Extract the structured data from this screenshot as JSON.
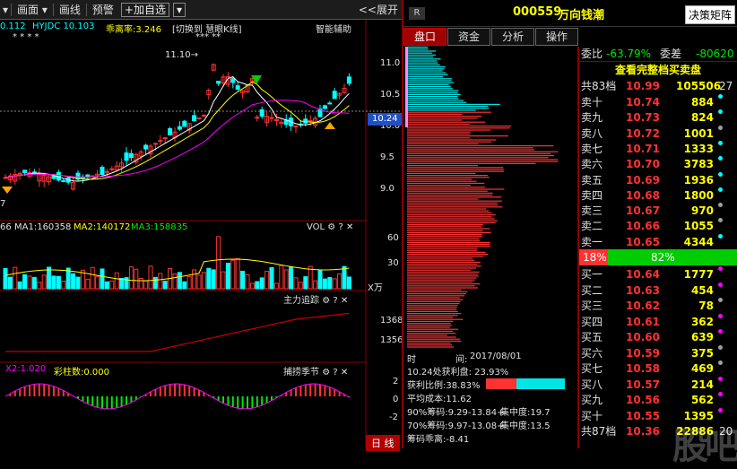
{
  "toolbar": {
    "items": [
      "画面",
      "画线",
      "预警"
    ],
    "add_fav": "加自选",
    "expand": "<<展开"
  },
  "indicator_line": {
    "val": "0.112",
    "hyjdc": "HYJDC 10.103",
    "ratio": "乖离率:3.246",
    "stars": "*** **",
    "trend": "[切换到 慧眼K线]",
    "assist": "智能辅助"
  },
  "price_axis": [
    "11.0",
    "10.5",
    "10.0",
    "9.5",
    "9.0"
  ],
  "current_price_tag": "10.24",
  "high_label": "11.10",
  "low_label": "7",
  "vol_header": {
    "a": "66",
    "ma1": "MA1:160358",
    "ma2": "MA2:140172",
    "ma3": "MA3:158835",
    "label": "VOL"
  },
  "vol_axis": [
    "60",
    "30"
  ],
  "vol_unit": "X万",
  "main_track": {
    "label": "主力追踪",
    "axis": [
      "1368",
      "1356"
    ]
  },
  "capture": {
    "x2": "X2:1.020",
    "color_bar": "彩柱数:0.000",
    "label": "捕捞季节",
    "axis": [
      "2",
      "0",
      "-2"
    ]
  },
  "period_button": "日 线",
  "right_header": {
    "badge": "R",
    "code": "000559",
    "name": "万向钱潮",
    "matrix_button": "决策矩阵"
  },
  "right_tabs": [
    "盘口",
    "资金",
    "分析",
    "操作"
  ],
  "chip": {
    "time_label": "时",
    "time_key": "间:",
    "time_value": "2017/08/01",
    "profit_price": "10.24处获利盘: 23.93%",
    "profit_ratio": "获利比例:38.83%",
    "avg_cost": "平均成本:11.62",
    "c90": "90%筹码:9.29-13.84+",
    "c90_conc": "集中度:19.7",
    "c70": "70%筹码:9.97-13.08+",
    "c70_conc": "集中度:13.5",
    "dev": "筹码乖离:-8.41",
    "profit_ratio_value": 0.3883
  },
  "order_book": {
    "wb": {
      "label": "委比",
      "value": "-63.79%",
      "diff_label": "委差",
      "diff": "-80620"
    },
    "view_all": "查看完整档买卖盘",
    "sell_total": {
      "label": "共83档",
      "price": "10.99",
      "vol": "105506",
      "n": "27"
    },
    "sells": [
      {
        "label": "卖十",
        "price": "10.74",
        "vol": "884",
        "dot": "#00ffff"
      },
      {
        "label": "卖九",
        "price": "10.73",
        "vol": "824",
        "dot": "#00ffff"
      },
      {
        "label": "卖八",
        "price": "10.72",
        "vol": "1001",
        "dot": "#a0a0a0"
      },
      {
        "label": "卖七",
        "price": "10.71",
        "vol": "1333",
        "dot": "#00ffff"
      },
      {
        "label": "卖六",
        "price": "10.70",
        "vol": "3783",
        "dot": "#00ffff"
      },
      {
        "label": "卖五",
        "price": "10.69",
        "vol": "1936",
        "dot": "#00ffff"
      },
      {
        "label": "卖四",
        "price": "10.68",
        "vol": "1800",
        "dot": "#00ffff"
      },
      {
        "label": "卖三",
        "price": "10.67",
        "vol": "970",
        "dot": "#a0a0a0"
      },
      {
        "label": "卖二",
        "price": "10.66",
        "vol": "1055",
        "dot": "#a0a0a0"
      },
      {
        "label": "卖一",
        "price": "10.65",
        "vol": "4344",
        "dot": "#00ffff"
      }
    ],
    "ratio_bar": {
      "left": "18%",
      "right": "82%",
      "left_value": 0.18
    },
    "buys": [
      {
        "label": "买一",
        "price": "10.64",
        "vol": "1777",
        "dot": "#ff00ff"
      },
      {
        "label": "买二",
        "price": "10.63",
        "vol": "454",
        "dot": "#ff00ff"
      },
      {
        "label": "买三",
        "price": "10.62",
        "vol": "78",
        "dot": "#a0a0a0"
      },
      {
        "label": "买四",
        "price": "10.61",
        "vol": "362",
        "dot": "#ff00ff"
      },
      {
        "label": "买五",
        "price": "10.60",
        "vol": "639",
        "dot": "#ff00ff"
      },
      {
        "label": "买六",
        "price": "10.59",
        "vol": "375",
        "dot": "#a0a0a0"
      },
      {
        "label": "买七",
        "price": "10.58",
        "vol": "469",
        "dot": "#a0a0a0"
      },
      {
        "label": "买八",
        "price": "10.57",
        "vol": "214",
        "dot": "#ff00ff"
      },
      {
        "label": "买九",
        "price": "10.56",
        "vol": "562",
        "dot": "#ff00ff"
      },
      {
        "label": "买十",
        "price": "10.55",
        "vol": "1395",
        "dot": "#ff00ff"
      }
    ],
    "buy_total": {
      "label": "共87档",
      "price": "10.36",
      "vol": "22886",
      "n": "20"
    }
  },
  "colors": {
    "up": "#ff3232",
    "down": "#00ffff",
    "ma5": "#ffffff",
    "ma10": "#ffff00",
    "ma20": "#ff00ff",
    "accent": "#a00000"
  }
}
